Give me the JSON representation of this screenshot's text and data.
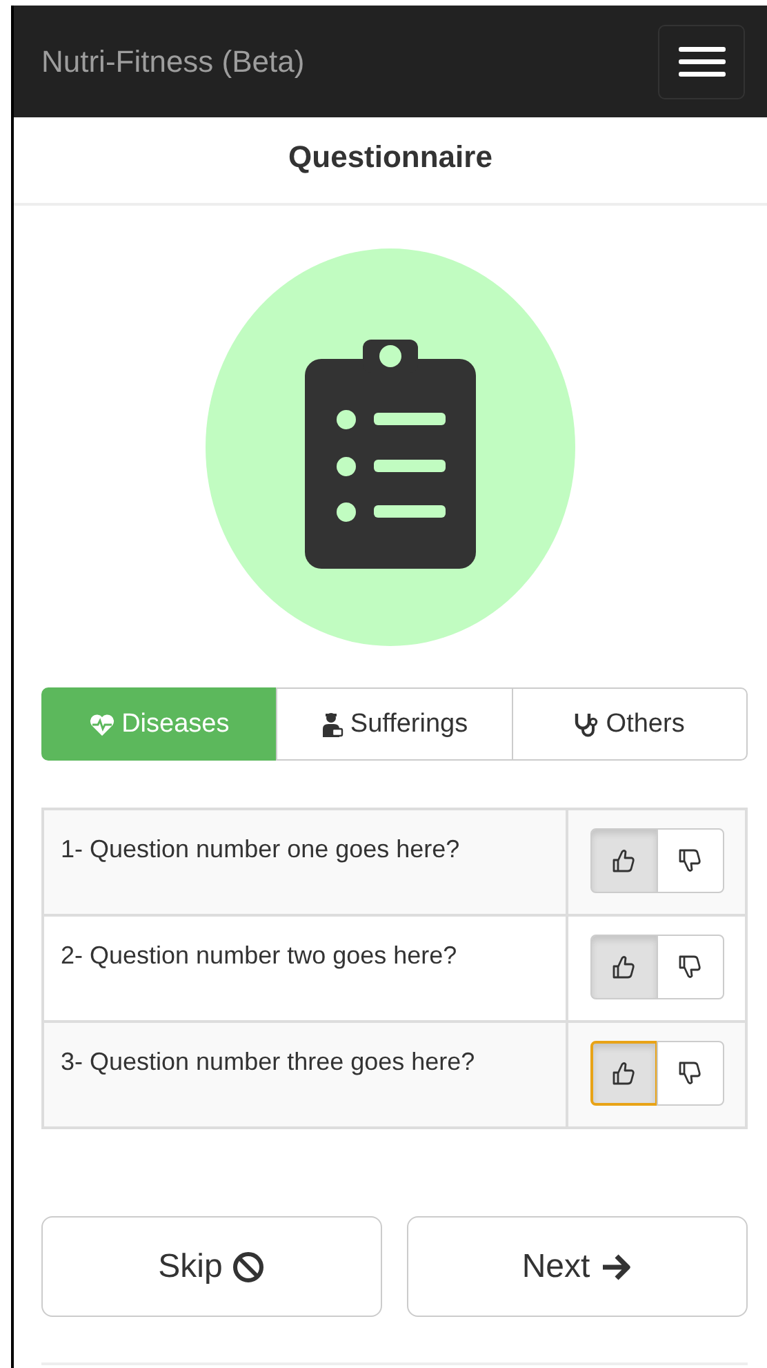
{
  "navbar": {
    "title": "Nutri-Fitness (Beta)"
  },
  "header": {
    "title": "Questionnaire"
  },
  "tabs": [
    {
      "label": "Diseases",
      "kind": "heart",
      "selected": true
    },
    {
      "label": "Sufferings",
      "kind": "patient",
      "selected": false
    },
    {
      "label": "Others",
      "kind": "stethoscope",
      "selected": false
    }
  ],
  "questions": [
    {
      "text": "1- Question number one goes here?",
      "liked": true,
      "disliked": false,
      "focused": false
    },
    {
      "text": "2- Question number two goes here?",
      "liked": true,
      "disliked": false,
      "focused": false
    },
    {
      "text": "3- Question number three goes here?",
      "liked": true,
      "disliked": false,
      "focused": true
    }
  ],
  "buttons": [
    {
      "label": "Skip",
      "kind": "skip"
    },
    {
      "label": "Next",
      "kind": "next"
    }
  ]
}
